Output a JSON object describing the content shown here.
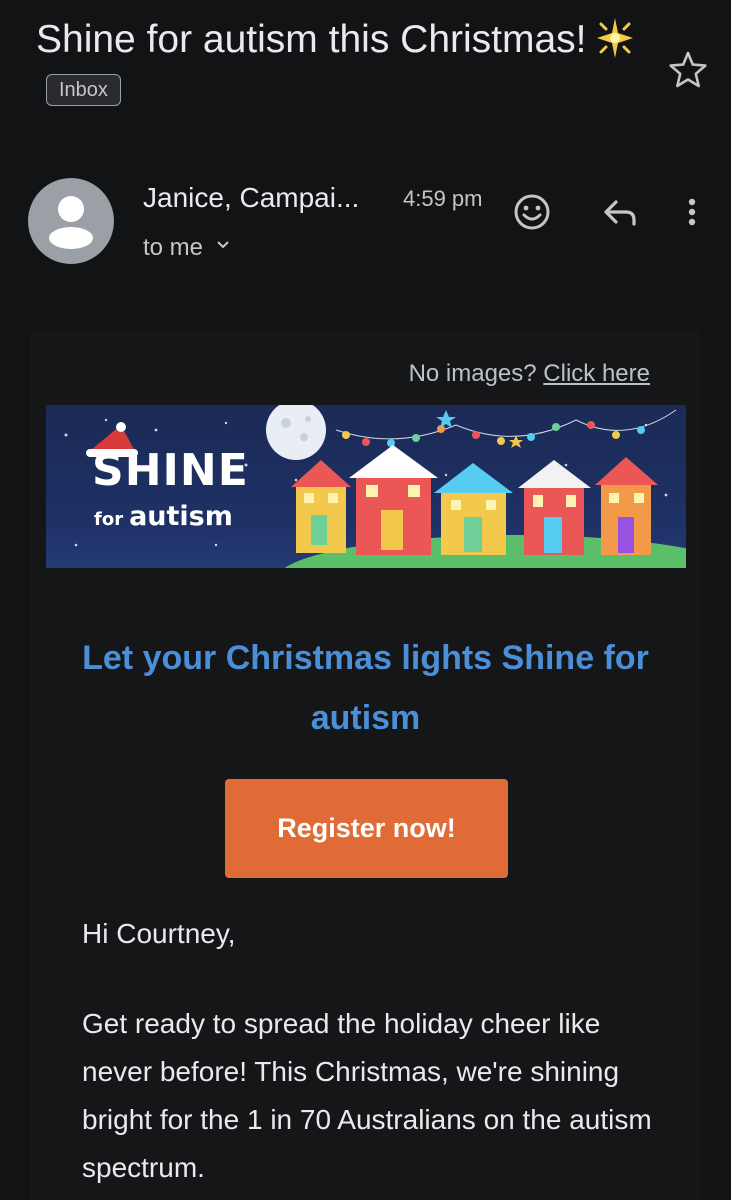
{
  "email": {
    "subject": "Shine for autism this Christmas!",
    "label_chip": "Inbox",
    "sender": "Janice, Campai...",
    "time": "4:59 pm",
    "recipient": "to me"
  },
  "body": {
    "no_images_text": "No images?",
    "click_here": "Click here",
    "banner": {
      "logo_main": "SHINE",
      "logo_for": "for",
      "logo_autism": "autism"
    },
    "headline": "Let your Christmas lights Shine for autism",
    "cta_label": "Register now!",
    "greeting": "Hi Courtney,",
    "paragraph": "Get ready to spread the holiday cheer like never before! This Christmas, we're shining bright for the 1 in 70 Australians on the autism spectrum."
  },
  "colors": {
    "background": "#121315",
    "headline": "#4a8fd8",
    "cta": "#e16b37"
  },
  "icons": [
    "sparkle-icon",
    "star-icon",
    "avatar-person-icon",
    "chevron-down-icon",
    "add-reaction-icon",
    "reply-icon",
    "more-vert-icon"
  ]
}
